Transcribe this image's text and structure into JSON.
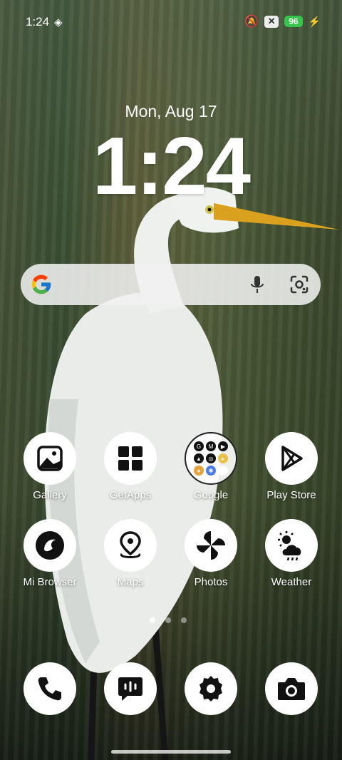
{
  "status_bar": {
    "time": "1:24",
    "battery": "96"
  },
  "lockclock": {
    "date": "Mon, Aug 17",
    "time": "1:24"
  },
  "apps_row1": [
    {
      "label": "Gallery",
      "icon": "gallery-icon"
    },
    {
      "label": "GetApps",
      "icon": "getapps-icon"
    },
    {
      "label": "Google",
      "icon": "google-folder-icon"
    },
    {
      "label": "Play Store",
      "icon": "play-store-icon"
    }
  ],
  "apps_row2": [
    {
      "label": "Mi Browser",
      "icon": "mi-browser-icon"
    },
    {
      "label": "Maps",
      "icon": "maps-icon"
    },
    {
      "label": "Photos",
      "icon": "photos-icon"
    },
    {
      "label": "Weather",
      "icon": "weather-icon"
    }
  ],
  "dock": [
    {
      "icon": "phone-icon"
    },
    {
      "icon": "messages-icon"
    },
    {
      "icon": "settings-icon"
    },
    {
      "icon": "camera-icon"
    }
  ],
  "page_indicator": {
    "count": 3,
    "active": 0
  },
  "colors": {
    "battery": "#36c44a"
  }
}
